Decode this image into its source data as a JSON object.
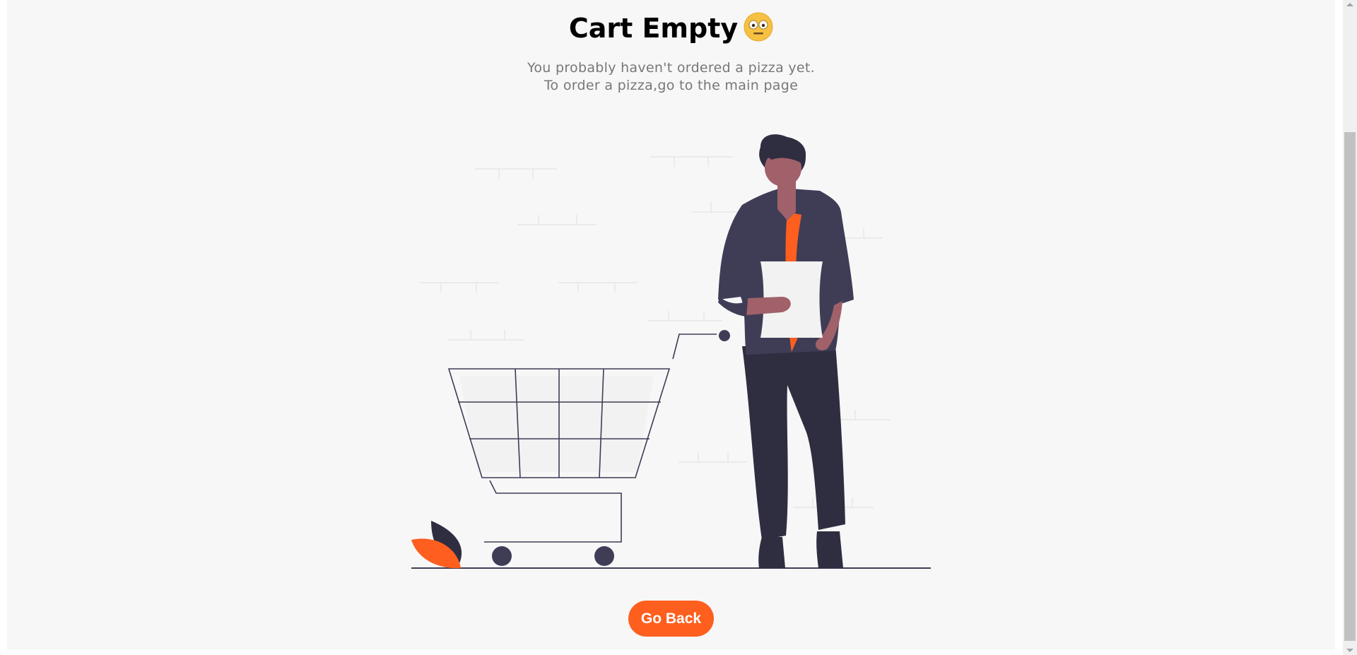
{
  "cart": {
    "title": "Cart Empty",
    "subtitle_line1": "You probably haven't ordered a pizza yet.",
    "subtitle_line2": "To order a pizza,go to the main page",
    "emoji_icon": "neutral-face-emoji-icon"
  },
  "actions": {
    "go_back_label": "Go Back"
  },
  "colors": {
    "accent": "#fe5f1e",
    "dark": "#3f3d56",
    "skin": "#a0616a",
    "pants": "#2f2e41",
    "page_bg": "#f7f7f7"
  }
}
